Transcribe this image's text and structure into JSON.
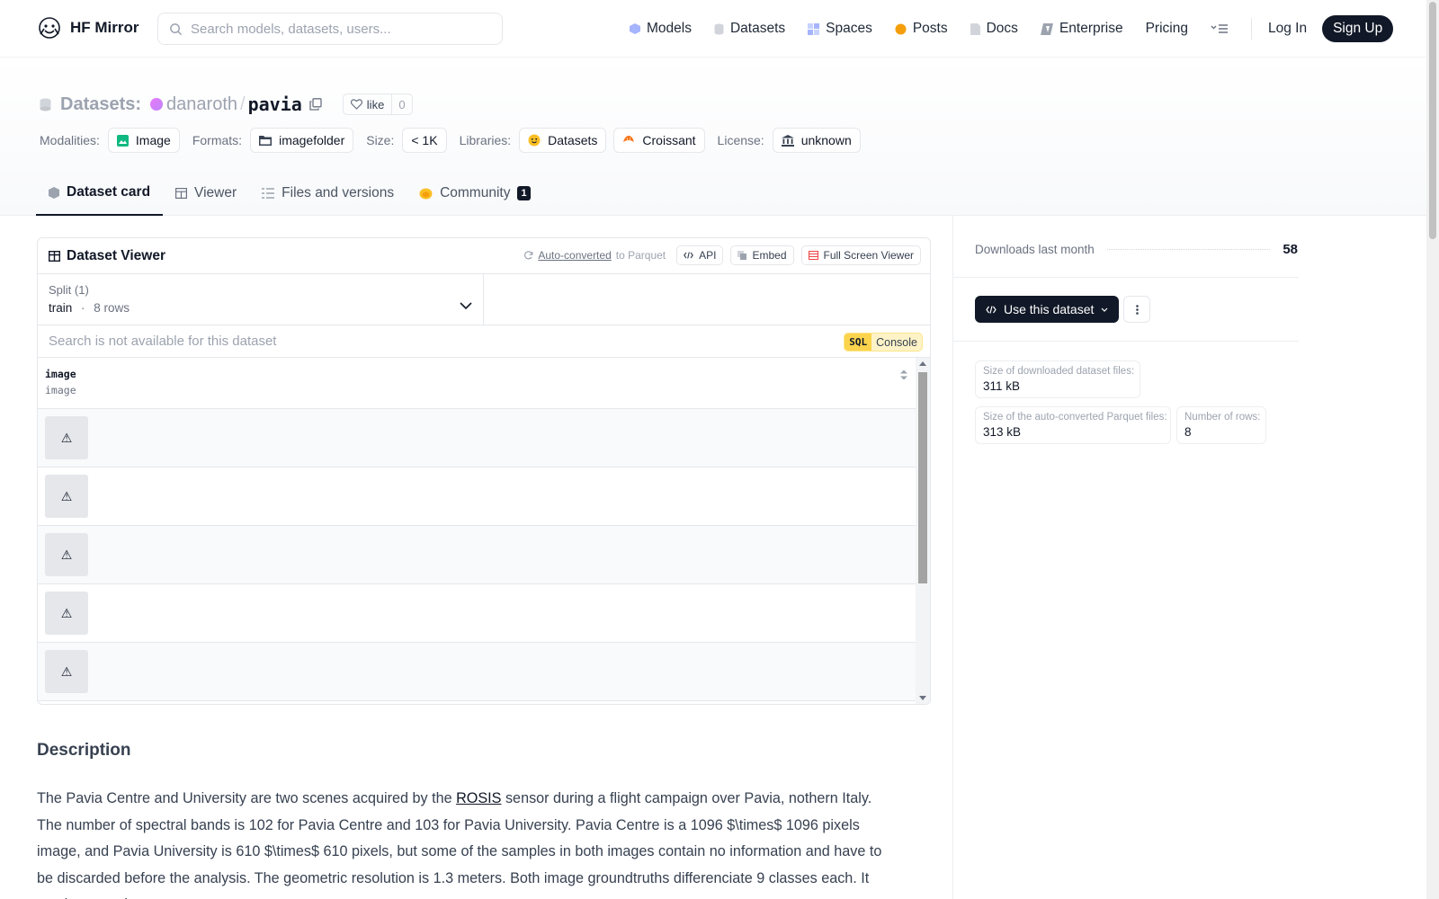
{
  "nav": {
    "brand": "HF Mirror",
    "search_placeholder": "Search models, datasets, users...",
    "links": [
      "Models",
      "Datasets",
      "Spaces",
      "Posts",
      "Docs",
      "Enterprise",
      "Pricing"
    ],
    "login": "Log In",
    "signup": "Sign Up"
  },
  "header": {
    "prefix": "Datasets:",
    "owner": "danaroth",
    "repo": "pavia",
    "like_label": "like",
    "like_count": "0",
    "modalities_label": "Modalities:",
    "modality": "Image",
    "formats_label": "Formats:",
    "format": "imagefolder",
    "size_label": "Size:",
    "size": "< 1K",
    "libraries_label": "Libraries:",
    "libraries": [
      "Datasets",
      "Croissant"
    ],
    "license_label": "License:",
    "license": "unknown"
  },
  "tabs": [
    {
      "label": "Dataset card",
      "active": true
    },
    {
      "label": "Viewer"
    },
    {
      "label": "Files and versions"
    },
    {
      "label": "Community",
      "badge": "1"
    }
  ],
  "viewer": {
    "title": "Dataset Viewer",
    "autoconverted_link": "Auto-converted",
    "autoconverted_suffix": "to Parquet",
    "api": "API",
    "embed": "Embed",
    "fullscreen": "Full Screen Viewer",
    "split_label": "Split (1)",
    "split_name": "train",
    "split_sep": "·",
    "split_rows": "8 rows",
    "search_disabled": "Search is not available for this dataset",
    "sql": "SQL",
    "console": "Console",
    "column_name": "image",
    "column_type": "image",
    "row_glyph": "⚠"
  },
  "description": {
    "heading": "Description",
    "before_link": "The Pavia Centre and University are two scenes acquired by the ",
    "link": "ROSIS",
    "after_link": " sensor during a flight campaign over Pavia, nothern Italy. The number of spectral bands is 102 for Pavia Centre and 103 for Pavia University. Pavia Centre is a 1096 $\\times$ 1096 pixels image, and Pavia University is 610 $\\times$ 610 pixels, but some of the samples in both images contain no information and have to be discarded before the analysis. The geometric resolution is 1.3 meters. Both image groundtruths differenciate 9 classes each. It can be seen the"
  },
  "sidebar": {
    "downloads_label": "Downloads last month",
    "downloads_value": "58",
    "use_dataset": "Use this dataset",
    "stats": [
      {
        "label": "Size of downloaded dataset files:",
        "value": "311 kB"
      },
      {
        "label": "Size of the auto-converted Parquet files:",
        "value": "313 kB"
      },
      {
        "label": "Number of rows:",
        "value": "8"
      }
    ]
  }
}
